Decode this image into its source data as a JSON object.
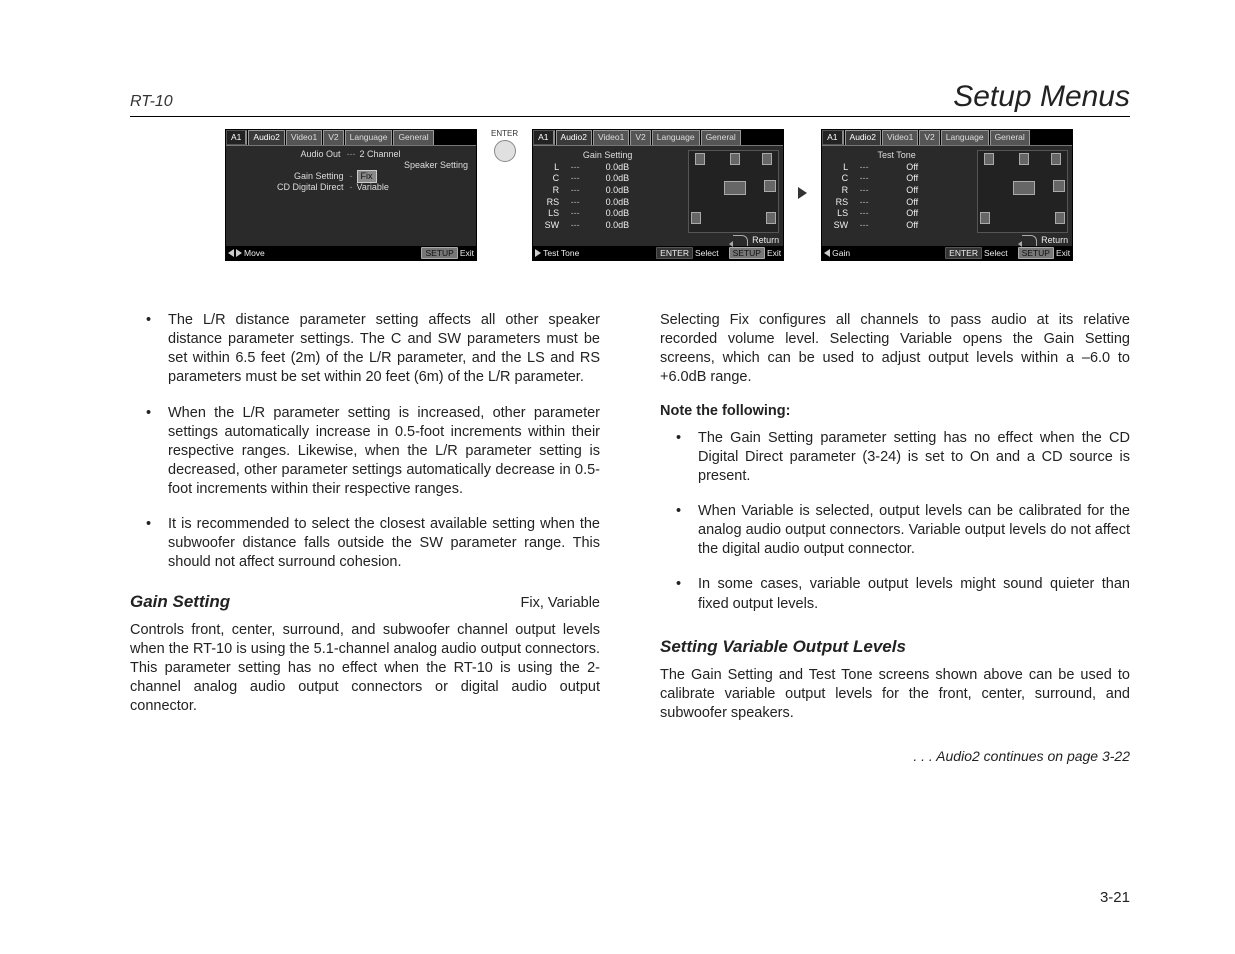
{
  "header": {
    "model": "RT-10",
    "title": "Setup Menus"
  },
  "tablist": {
    "a1": "A1",
    "audio2": "Audio2",
    "video1": "Video1",
    "v2": "V2",
    "language": "Language",
    "general": "General"
  },
  "shot1": {
    "rows": [
      {
        "label": "Audio Out",
        "value": "2 Channel"
      },
      {
        "label": "Speaker Setting",
        "value": ""
      },
      {
        "label": "Gain Setting",
        "value": "Fix",
        "hl": true
      },
      {
        "label": "CD Digital Direct",
        "value": "Variable"
      }
    ],
    "move": "Move",
    "setup": "SETUP",
    "exit": "Exit",
    "enter": "ENTER"
  },
  "shot2": {
    "title": "Gain Setting",
    "rows": [
      {
        "ch": "L",
        "dash": "---",
        "val": "0.0dB"
      },
      {
        "ch": "C",
        "dash": "---",
        "val": "0.0dB"
      },
      {
        "ch": "R",
        "dash": "---",
        "val": "0.0dB"
      },
      {
        "ch": "RS",
        "dash": "---",
        "val": "0.0dB"
      },
      {
        "ch": "LS",
        "dash": "---",
        "val": "0.0dB"
      },
      {
        "ch": "SW",
        "dash": "---",
        "val": "0.0dB"
      }
    ],
    "return": "Return",
    "bl_left": "Test Tone",
    "bl_enter": "ENTER",
    "bl_select": "Select",
    "bl_setup": "SETUP",
    "bl_exit": "Exit"
  },
  "shot3": {
    "title": "Test Tone",
    "rows": [
      {
        "ch": "L",
        "dash": "---",
        "val": "Off"
      },
      {
        "ch": "C",
        "dash": "---",
        "val": "Off"
      },
      {
        "ch": "R",
        "dash": "---",
        "val": "Off"
      },
      {
        "ch": "RS",
        "dash": "---",
        "val": "Off"
      },
      {
        "ch": "LS",
        "dash": "---",
        "val": "Off"
      },
      {
        "ch": "SW",
        "dash": "---",
        "val": "Off"
      }
    ],
    "return": "Return",
    "bl_left": "Gain",
    "bl_enter": "ENTER",
    "bl_select": "Select",
    "bl_setup": "SETUP",
    "bl_exit": "Exit"
  },
  "left_col": {
    "b1": "The L/R distance parameter setting affects all other speaker distance parameter settings. The C and SW parameters must be set within 6.5 feet (2m) of the L/R parameter, and the LS and RS parameters must be set within 20 feet (6m) of the L/R parameter.",
    "b2": "When the L/R parameter setting is increased, other parameter settings automatically increase in 0.5-foot increments within their respective ranges. Likewise, when the L/R parameter setting is decreased, other parameter settings automatically decrease in 0.5-foot increments within their respective ranges.",
    "b3": "It is recommended to select the closest available setting when the subwoofer distance falls outside the SW parameter range. This should not affect surround cohesion.",
    "sect_title": "Gain Setting",
    "sect_opts": "Fix, Variable",
    "sect_para": "Controls front, center, surround, and subwoofer channel output levels when the RT-10 is using the 5.1-channel analog audio output connectors. This parameter setting has no effect when the RT-10 is using the 2-channel analog audio output connectors or digital audio output connector."
  },
  "right_col": {
    "p1": "Selecting Fix configures all channels to pass audio at its relative recorded volume level. Selecting Variable opens the Gain Setting screens, which can be used to adjust output levels within a –6.0 to +6.0dB range.",
    "note_head": "Note the following:",
    "b1": "The Gain Setting parameter setting has no effect when the CD Digital Direct parameter (3-24) is set to On and a CD source is present.",
    "b2": "When Variable is selected, output levels can be calibrated for the analog audio output connectors. Variable output levels do not affect the digital audio output connector.",
    "b3": "In some cases, variable output levels might sound quieter than fixed output levels.",
    "sub_title": "Setting Variable Output Levels",
    "sub_para": "The Gain Setting and Test Tone screens shown above can be used to calibrate variable output levels for the front, center, surround, and subwoofer speakers.",
    "cont": ". . . Audio2 continues on page 3-22"
  },
  "page_num": "3-21"
}
